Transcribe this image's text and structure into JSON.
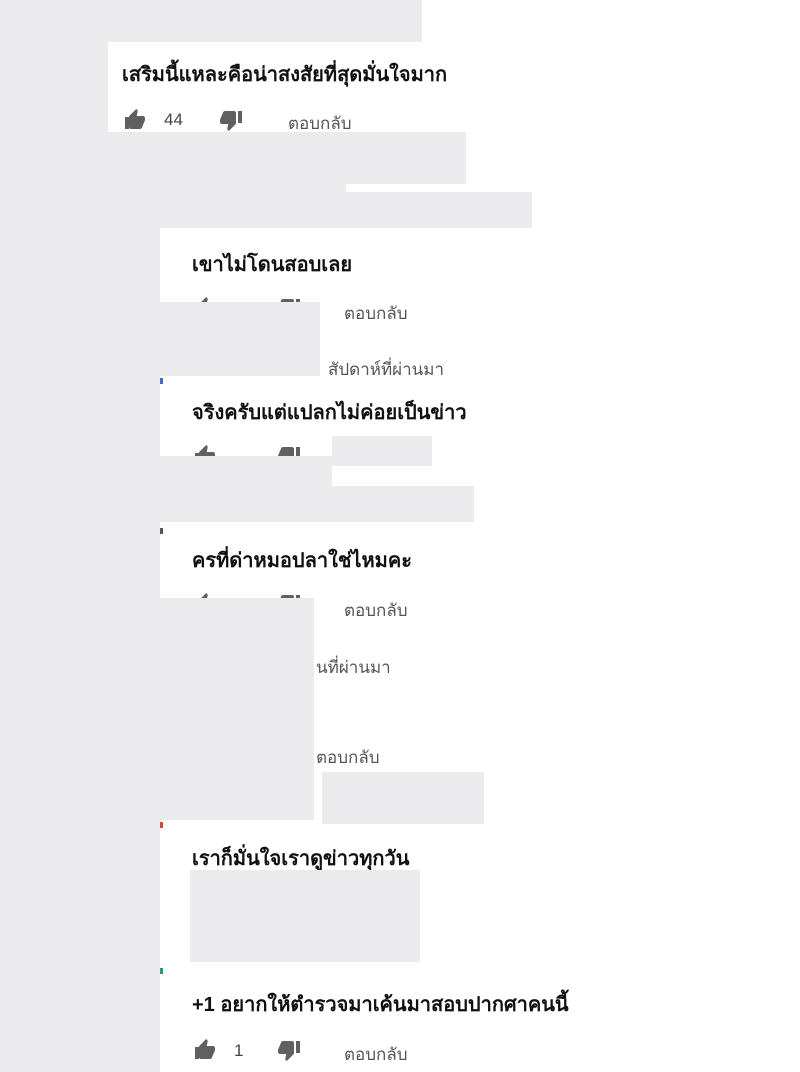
{
  "comments": [
    {
      "text": "เสริมนี้แหละคือน่าสงสัยที่สุดมั่นใจมาก",
      "likes": "44",
      "reply": "ตอบกลับ"
    },
    {
      "text": "เขาไม่โดนสอบเลย",
      "reply": "ตอบกลับ"
    },
    {
      "text": "จริงครับแต่แปลกไม่ค่อยเป็นข่าว"
    },
    {
      "text": "ครที่ด่าหมอปลาใช่ไหมคะ",
      "reply": "ตอบกลับ"
    },
    {
      "text": "เราก็มั่นใจเราดูข่าวทุกวัน"
    },
    {
      "text": "+1 อยากให้ตำรวจมาเค้นมาสอบปากศาคนนี้",
      "likes": "1",
      "reply": "ตอบกลับ"
    }
  ],
  "fragments": {
    "time_1": "สัปดาห์ที่ผ่านมา",
    "time_2": "นที่ผ่านมา",
    "reply_extra": "ตอบกลับ"
  },
  "icons": {
    "like": "thumbs-up-icon",
    "dislike": "thumbs-down-icon"
  },
  "colors": {
    "background": "#ffffff",
    "redaction": "#ebebed",
    "icon": "#606060"
  }
}
